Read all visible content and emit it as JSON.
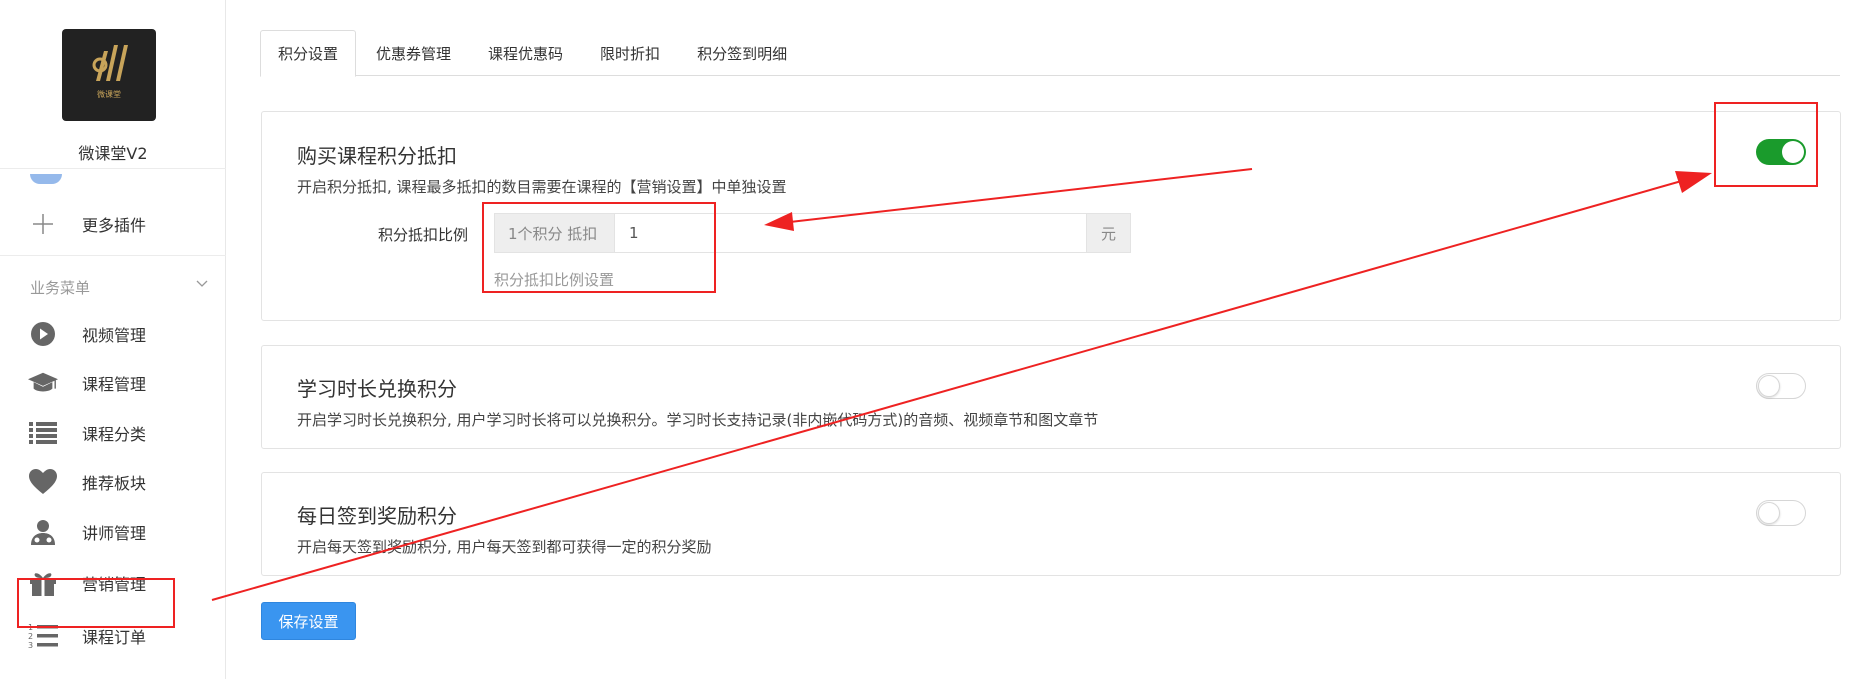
{
  "app": {
    "logo_text": "微课堂",
    "name": "微课堂V2"
  },
  "sidebar": {
    "more_plugins": "更多插件",
    "section_title": "业务菜单",
    "items": [
      {
        "label": "视频管理",
        "icon": "play-circle-icon"
      },
      {
        "label": "课程管理",
        "icon": "graduation-cap-icon"
      },
      {
        "label": "课程分类",
        "icon": "list-icon"
      },
      {
        "label": "推荐板块",
        "icon": "heart-icon"
      },
      {
        "label": "讲师管理",
        "icon": "teacher-icon"
      },
      {
        "label": "营销管理",
        "icon": "gift-icon",
        "highlighted": true
      },
      {
        "label": "课程订单",
        "icon": "ordered-list-icon"
      }
    ]
  },
  "tabs": [
    {
      "label": "积分设置",
      "active": true
    },
    {
      "label": "优惠券管理"
    },
    {
      "label": "课程优惠码"
    },
    {
      "label": "限时折扣"
    },
    {
      "label": "积分签到明细"
    }
  ],
  "panels": {
    "purchase": {
      "title": "购买课程积分抵扣",
      "desc": "开启积分抵扣, 课程最多抵扣的数目需要在课程的【营销设置】中单独设置",
      "enabled": true,
      "field_label": "积分抵扣比例",
      "prefix": "1个积分 抵扣",
      "value": "1",
      "suffix": "元",
      "help": "积分抵扣比例设置"
    },
    "study": {
      "title": "学习时长兑换积分",
      "desc": "开启学习时长兑换积分, 用户学习时长将可以兑换积分。学习时长支持记录(非内嵌代码方式)的音频、视频章节和图文章节",
      "enabled": false
    },
    "checkin": {
      "title": "每日签到奖励积分",
      "desc": "开启每天签到奖励积分, 用户每天签到都可获得一定的积分奖励",
      "enabled": false
    }
  },
  "save_button": "保存设置",
  "colors": {
    "switch_on": "#1a9b2c",
    "primary": "#3a95f0",
    "annotation": "#ee2222"
  }
}
